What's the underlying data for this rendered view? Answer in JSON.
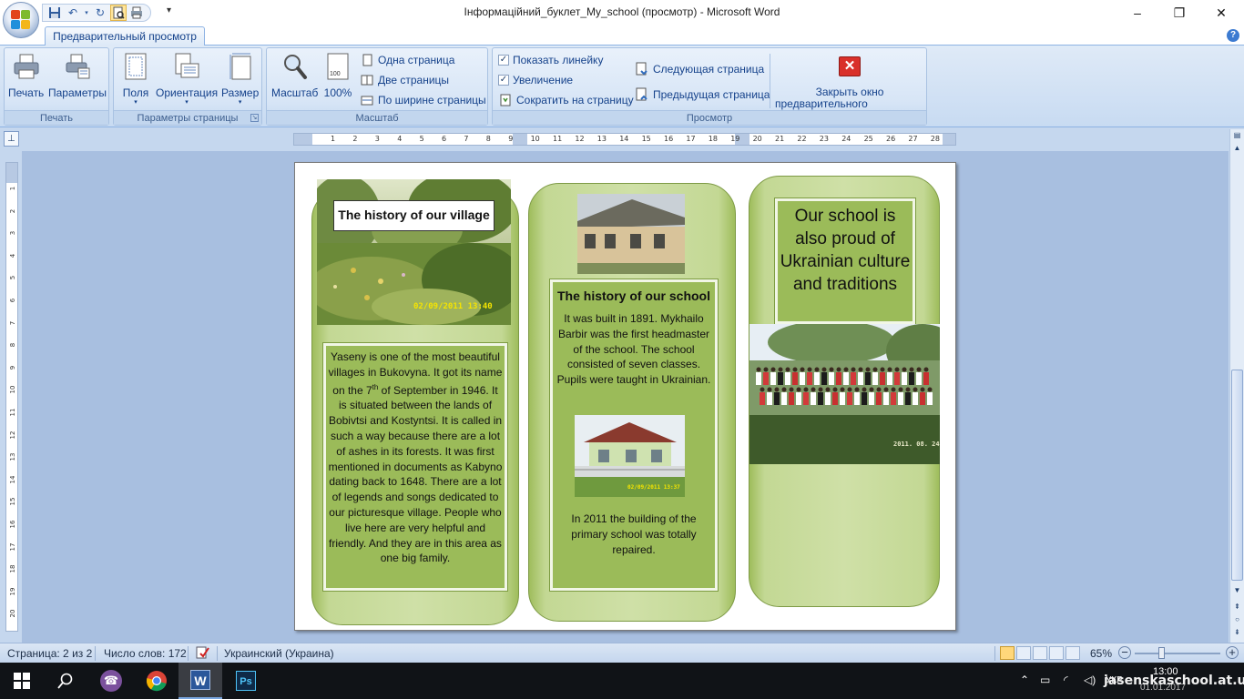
{
  "window": {
    "title": "Інформаційний_буклет_My_school (просмотр) - Microsoft Word",
    "minimize": "–",
    "maximize": "❐",
    "close": "✕"
  },
  "ribbon": {
    "active_tab": "Предварительный просмотр",
    "help": "?",
    "groups": {
      "print": {
        "label": "Печать",
        "print_button": "Печать",
        "options_button": "Параметры"
      },
      "page_setup": {
        "label": "Параметры страницы",
        "margins": "Поля",
        "orientation": "Ориентация",
        "size": "Размер"
      },
      "zoom": {
        "label": "Масштаб",
        "zoom_button": "Масштаб",
        "zoom_100": "100%",
        "one_page": "Одна страница",
        "two_pages": "Две страницы",
        "page_width": "По ширине страницы"
      },
      "preview": {
        "label": "Просмотр",
        "show_ruler": "Показать линейку",
        "show_ruler_checked": true,
        "magnifier": "Увеличение",
        "magnifier_checked": true,
        "shrink_one_page": "Сократить на страницу",
        "next_page": "Следующая страница",
        "previous_page": "Предыдущая страница",
        "close_preview_line1": "Закрыть окно",
        "close_preview_line2": "предварительного просмотра"
      }
    }
  },
  "ruler": {
    "h_ticks": [
      "1",
      "2",
      "3",
      "4",
      "5",
      "6",
      "7",
      "8",
      "9",
      "10",
      "11",
      "12",
      "13",
      "14",
      "15",
      "16",
      "17",
      "18",
      "19",
      "20",
      "21",
      "22",
      "23",
      "24",
      "25",
      "26",
      "27",
      "28"
    ],
    "v_ticks": [
      "1",
      "2",
      "3",
      "4",
      "5",
      "6",
      "7",
      "8",
      "9",
      "10",
      "11",
      "12",
      "13",
      "14",
      "15",
      "16",
      "17",
      "18",
      "19",
      "20"
    ]
  },
  "document": {
    "col1": {
      "title": "The history of our village",
      "photo_timestamp": "02/09/2011  13:40",
      "body": "Yaseny is one of the most beautiful villages in Bukovyna. It got its name on the 7",
      "body_sup": "th",
      "body_rest": " of September in 1946. It is situated between the lands of Bobivtsi and Kostyntsi. It is called in such a way because there are a lot of ashes in its forests. It was first mentioned in documents as Kabyno dating back to 1648. There are a lot of legends and songs dedicated to our picturesque village. People who live here are very helpful and friendly.  And they are in this area as one big family."
    },
    "col2": {
      "title": "The history of our school",
      "body": "It was built in 1891. Mykhailo Barbir was the first headmaster of the school. The school consisted of seven classes. Pupils were taught in Ukrainian.",
      "photo_timestamp": "02/09/2011  13:37",
      "body2": "In 2011 the building of the primary school was totally repaired."
    },
    "col3": {
      "title": "Our school is also proud of Ukrainian culture and traditions",
      "photo_timestamp": "2011. 08. 24"
    }
  },
  "status": {
    "page": "Страница: 2 из 2",
    "words": "Число слов: 172",
    "language": "Украинский (Украина)",
    "zoom": "65%",
    "zoom_level_percent": 65
  },
  "taskbar": {
    "time": "13:00",
    "date": "01.01.2017",
    "lang": "УКР",
    "watermark": "jasenskaschool.at.ua"
  },
  "colors": {
    "accent_green": "#9bbb59",
    "ribbon_blue": "#15428b",
    "close_red": "#d9302a"
  }
}
